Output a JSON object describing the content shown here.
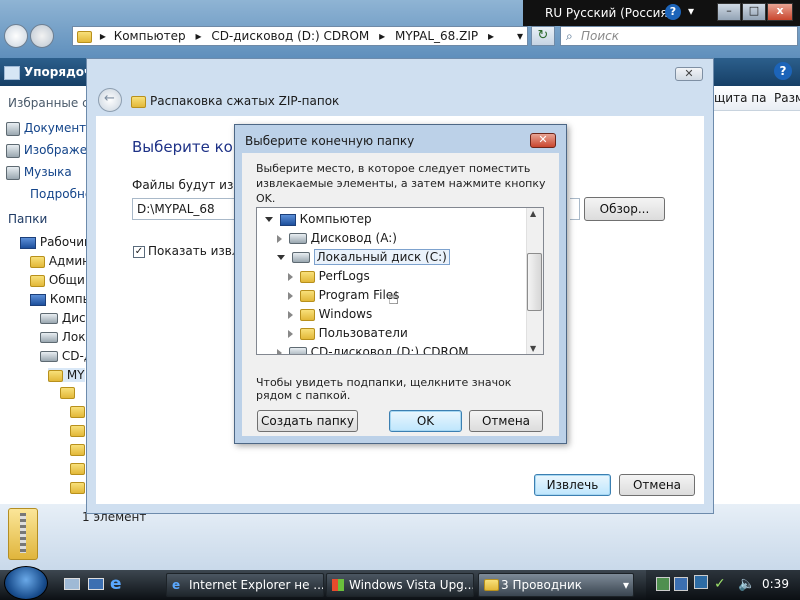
{
  "language_bar": {
    "language": "RU Русский (Россия)"
  },
  "explorer": {
    "address_parts": [
      "Компьютер",
      "CD-дисковод (D:) CDROM",
      "MYPAL_68.ZIP"
    ],
    "search_placeholder": "Поиск",
    "organize_label": "Упорядоч",
    "header_partial": [
      "щита па",
      "Разм"
    ],
    "left_pane": {
      "favorites_title": "Избранные сс",
      "favorites": [
        "Документ",
        "Изображе",
        "Музыка",
        "Подробне"
      ],
      "folders_title": "Папки",
      "tree": [
        "Рабочий",
        "Админ",
        "Общи",
        "Компь",
        "Диск",
        "Лока",
        "CD-д",
        "MY"
      ]
    },
    "status_text": "1 элемент"
  },
  "wizard": {
    "title": "Распаковка сжатых ZIP-папок",
    "heading": "Выберите коне",
    "files_label": "Файлы будут изв",
    "path_value": "D:\\MYPAL_68",
    "browse_button": "Обзор...",
    "show_label": "Показать извле",
    "extract_button": "Извлечь",
    "cancel_button": "Отмена"
  },
  "browse_dialog": {
    "title": "Выберите конечную папку",
    "instruction": "Выберите место, в которое следует поместить извлекаемые элементы, а затем нажмите кнопку OK.",
    "tree": {
      "computer": "Компьютер",
      "drive_a": "Дисковод (A:)",
      "drive_c": "Локальный диск (C:)",
      "folders": [
        "PerfLogs",
        "Program Files",
        "Windows",
        "Пользователи"
      ],
      "drive_d": "CD-дисковод (D:) CDROM"
    },
    "hint": "Чтобы увидеть подпапки, щелкните значок рядом с папкой.",
    "new_folder_button": "Создать папку",
    "ok_button": "OK",
    "cancel_button": "Отмена"
  },
  "taskbar": {
    "items": [
      "Internet Explorer не ...",
      "Windows Vista Upg...",
      "3 Проводник"
    ],
    "clock": "0:39"
  }
}
